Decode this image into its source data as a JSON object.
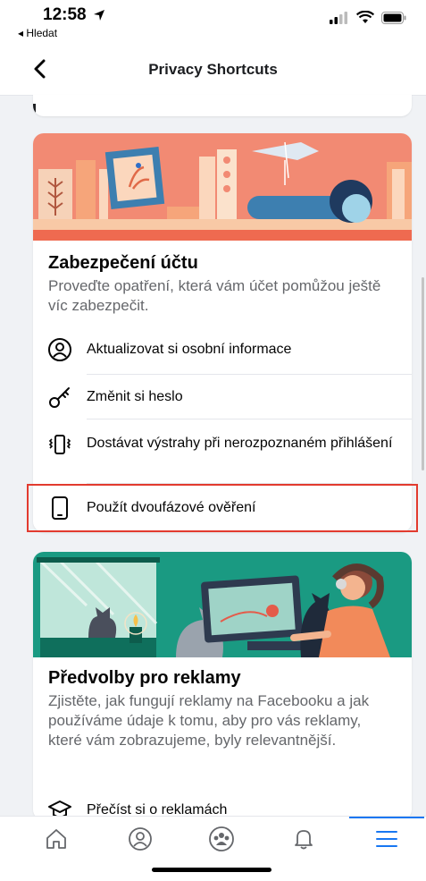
{
  "status_bar": {
    "time": "12:58",
    "back_app": "◂ Hledat"
  },
  "nav": {
    "title": "Privacy Shortcuts"
  },
  "security_card": {
    "title": "Zabezpečení účtu",
    "description": "Proveďte opatření, která vám účet pomůžou ještě víc zabezpečit.",
    "items": [
      {
        "label": "Aktualizovat si osobní informace",
        "icon": "user-circle-icon"
      },
      {
        "label": "Změnit si heslo",
        "icon": "key-icon"
      },
      {
        "label": "Dostávat výstrahy při nerozpoznaném přihlášení",
        "icon": "phone-vibrate-icon"
      },
      {
        "label": "Použít dvoufázové ověření",
        "icon": "phone-icon"
      }
    ]
  },
  "ads_card": {
    "title": "Předvolby pro reklamy",
    "description": "Zjistěte, jak fungují reklamy na Facebooku a jak používáme údaje k tomu, aby pro vás reklamy, které vám zobrazujeme, byly relevantnější.",
    "items": [
      {
        "label": "Přečíst si o reklamách",
        "icon": "graduation-cap-icon"
      }
    ]
  },
  "tabs": [
    {
      "name": "home",
      "icon": "home-icon"
    },
    {
      "name": "profile",
      "icon": "profile-icon"
    },
    {
      "name": "groups",
      "icon": "groups-icon"
    },
    {
      "name": "notifications",
      "icon": "bell-icon"
    },
    {
      "name": "menu",
      "icon": "menu-icon",
      "active": true
    }
  ],
  "colors": {
    "accent": "#1877f2",
    "highlight": "#e23b2f",
    "banner1_bg": "#f28a73",
    "banner2_bg": "#1a9a82"
  }
}
